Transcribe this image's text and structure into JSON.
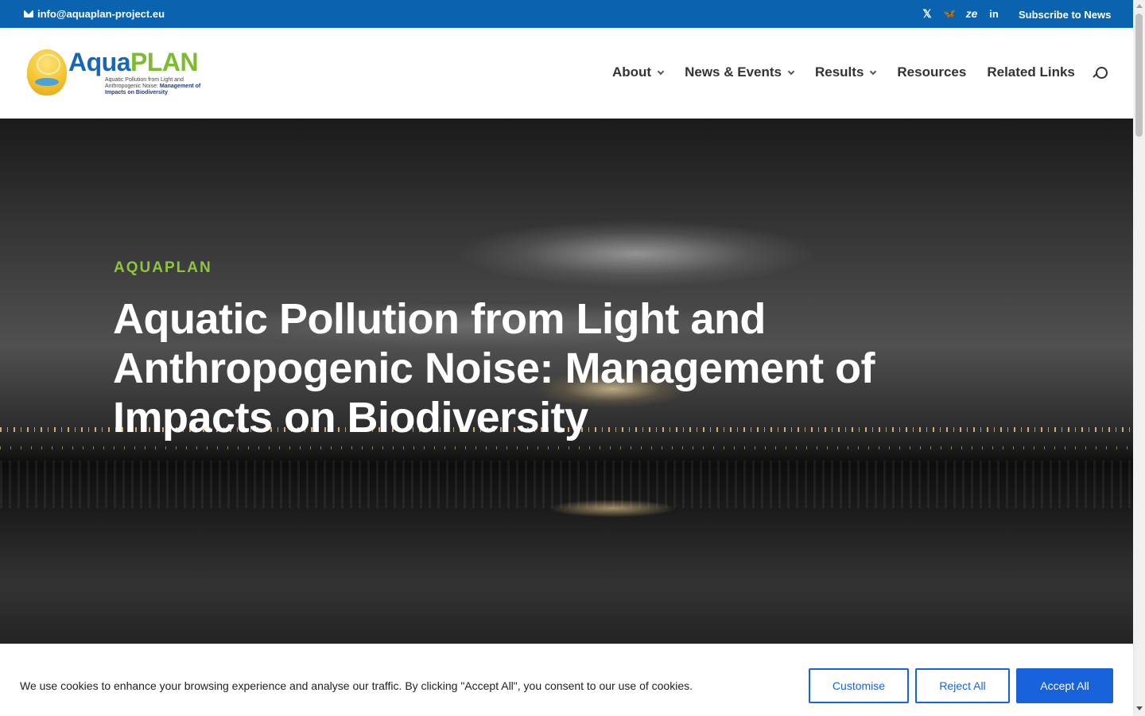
{
  "topbar": {
    "email": "info@aquaplan-project.eu",
    "socials": [
      {
        "icon": "x-twitter-icon",
        "glyph": "𝕏"
      },
      {
        "icon": "bluesky-icon",
        "glyph": "🦋"
      },
      {
        "icon": "zenodo-icon",
        "glyph": "ze"
      },
      {
        "icon": "linkedin-icon",
        "glyph": "in"
      }
    ],
    "subscribe_label": "Subscribe to News",
    "bg_color": "#0b63b0"
  },
  "header": {
    "logo": {
      "brand_part1": "Aqua",
      "brand_part2": "PLAN",
      "tagline_plain": "Aquatic Pollution from Light and Anthropogenic Noise: ",
      "tagline_bold": "Management of Impacts on Biodiversity"
    },
    "nav": {
      "about": "About",
      "news_events": "News & Events",
      "results": "Results",
      "resources": "Resources",
      "related_links": "Related Links"
    }
  },
  "hero": {
    "eyebrow": "AQUAPLAN",
    "headline": "Aquatic Pollution from Light and Anthropogenic Noise: Management of Impacts on Biodiversity",
    "eyebrow_color": "#8cc63f"
  },
  "cookie_banner": {
    "message": "We use cookies to enhance your browsing experience and analyse our traffic. By clicking \"Accept All\", you consent to our use of cookies.",
    "customise_label": "Customise",
    "reject_label": "Reject All",
    "accept_label": "Accept All",
    "accent_color": "#1863dc"
  }
}
